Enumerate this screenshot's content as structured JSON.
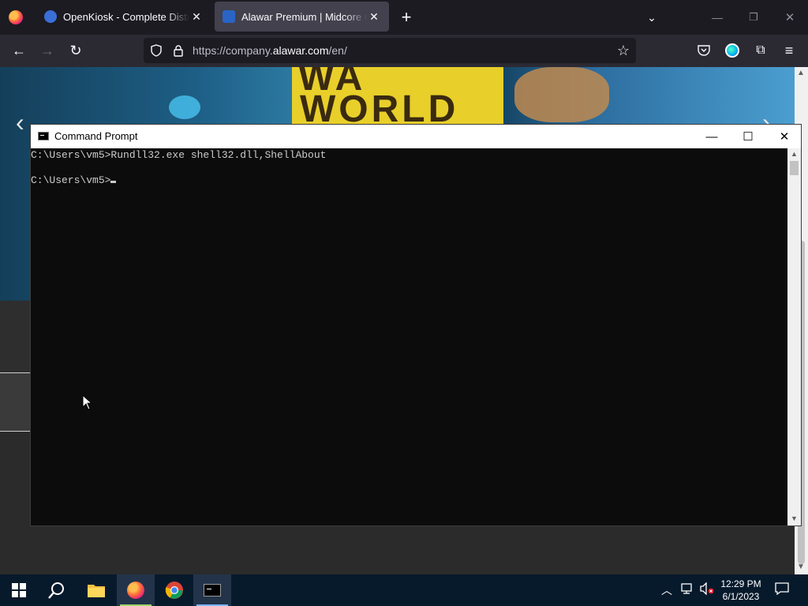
{
  "browser": {
    "tabs": [
      {
        "label": "OpenKiosk - Complete Distribu",
        "active": false
      },
      {
        "label": "Alawar Premium | Midcore Gar",
        "active": true
      }
    ],
    "url_prefix": "https://company.",
    "url_domain": "alawar.com",
    "url_suffix": "/en/"
  },
  "page": {
    "hero_text_line1": "WA",
    "hero_text_line2": "WORLD"
  },
  "cmd": {
    "title": "Command Prompt",
    "lines": [
      "C:\\Users\\vm5>Rundll32.exe shell32.dll,ShellAbout",
      "",
      "C:\\Users\\vm5>"
    ]
  },
  "taskbar": {
    "time": "12:29 PM",
    "date": "6/1/2023",
    "apps": [
      "start-icon",
      "search-icon",
      "file-explorer-icon",
      "firefox-icon",
      "chrome-icon",
      "command-prompt-icon"
    ]
  },
  "colors": {
    "accent": "#7ab5ff",
    "terminal_bg": "#0c0c0c",
    "terminal_fg": "#cccccc"
  }
}
